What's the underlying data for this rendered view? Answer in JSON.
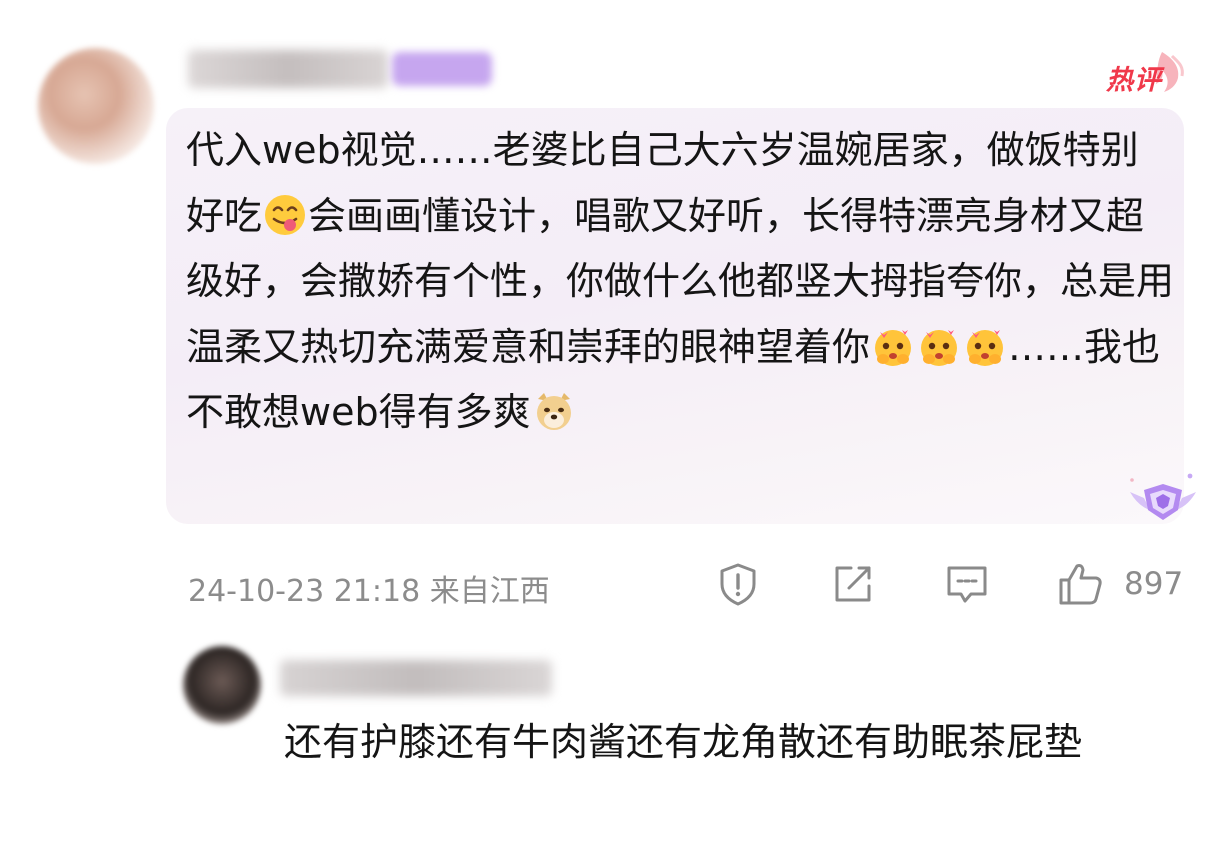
{
  "hot_label": "热评",
  "comment": {
    "segments": [
      "代入web视觉……老婆比自己大六岁温婉居家，做饭特别好吃",
      "会画画懂设计，唱歌又好听，长得特漂亮身材又超级好，会撒娇有个性，你做什么他都竖大拇指夸你，总是用温柔又热切充满爱意和崇拜的眼神望着你",
      "……我也不敢想web得有多爽"
    ],
    "meta": "24-10-23 21:18 来自江西",
    "like_count": "897"
  },
  "icons": {
    "report": "report-icon",
    "share": "share-icon",
    "reply": "reply-icon",
    "like": "thumbs-up-icon"
  },
  "reply": {
    "text": "还有护膝还有牛肉酱还有龙角散还有助眠茶屁垫"
  },
  "colors": {
    "bubble_bg": "#f5eff8",
    "hot_red": "#f0384a",
    "meta_gray": "#8c8c8c"
  }
}
